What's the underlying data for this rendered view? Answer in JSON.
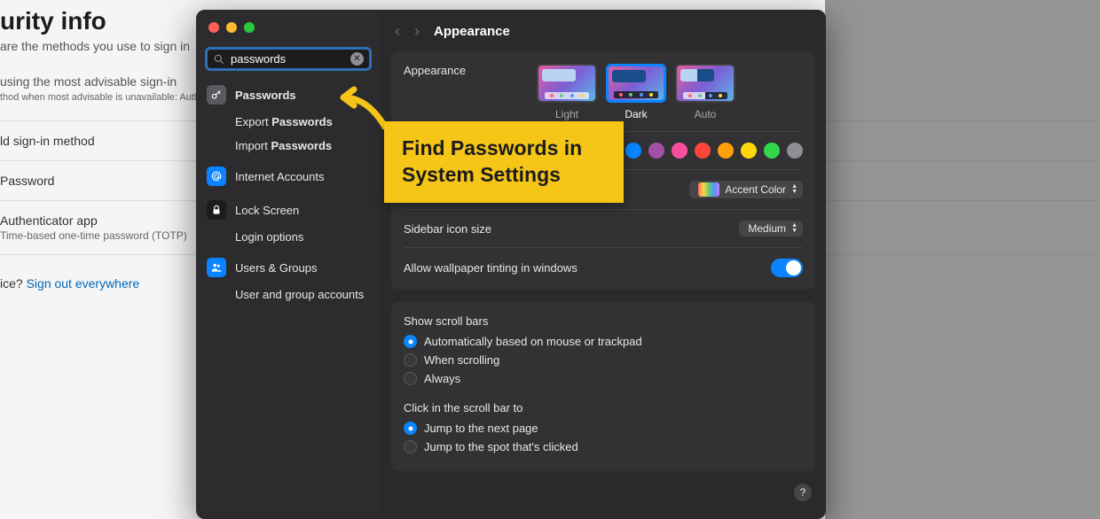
{
  "background": {
    "title_fragment": "urity info",
    "subtitle_fragment": "are the methods you use to sign in",
    "advice_line_fragment": "using the most advisable sign-in",
    "advice_small_fragment": "thod when most advisable is unavailable: Authe",
    "add_method_fragment": "ld sign-in method",
    "row1": "Password",
    "row2_title": "Authenticator app",
    "row2_sub": "Time-based one-time password (TOTP)",
    "question_fragment": "ice? ",
    "signout_link": "Sign out everywhere"
  },
  "window": {
    "search_value": "passwords",
    "title": "Appearance"
  },
  "sidebar": [
    {
      "icon": "key",
      "iconbg": "gray",
      "label_pre": "",
      "label_bold": "Passwords"
    },
    {
      "icon": "",
      "iconbg": "",
      "label_pre": "Export ",
      "label_bold": "Passwords"
    },
    {
      "icon": "",
      "iconbg": "",
      "label_pre": "Import ",
      "label_bold": "Passwords"
    },
    {
      "icon": "at",
      "iconbg": "blue",
      "label_pre": "Internet Accounts",
      "label_bold": ""
    },
    {
      "icon": "lock",
      "iconbg": "dark",
      "label_pre": "Lock Screen",
      "label_bold": ""
    },
    {
      "icon": "",
      "iconbg": "",
      "label_pre": "Login options",
      "label_bold": ""
    },
    {
      "icon": "users",
      "iconbg": "blue",
      "label_pre": "Users & Groups",
      "label_bold": ""
    },
    {
      "icon": "",
      "iconbg": "",
      "label_pre": "User and group accounts",
      "label_bold": ""
    }
  ],
  "appearance": {
    "label": "Appearance",
    "themes": [
      {
        "name": "Light",
        "selected": false
      },
      {
        "name": "Dark",
        "selected": true
      },
      {
        "name": "Auto",
        "selected": false
      }
    ],
    "accent_swatches": [
      "#0a84ff",
      "#a550a7",
      "#f74f9e",
      "#ff453a",
      "#ff9f0a",
      "#ffd60a",
      "#32d74b",
      "#8e8e93"
    ],
    "accent_label": "Accent Color",
    "sidebar_icon_label": "Sidebar icon size",
    "sidebar_icon_value": "Medium",
    "tinting_label": "Allow wallpaper tinting in windows",
    "tinting_on": true,
    "scroll_title": "Show scroll bars",
    "scroll_opts": [
      "Automatically based on mouse or trackpad",
      "When scrolling",
      "Always"
    ],
    "scroll_selected": 0,
    "click_title": "Click in the scroll bar to",
    "click_opts": [
      "Jump to the next page",
      "Jump to the spot that's clicked"
    ],
    "click_selected": 0
  },
  "callout": {
    "text": "Find Passwords in System Settings"
  }
}
